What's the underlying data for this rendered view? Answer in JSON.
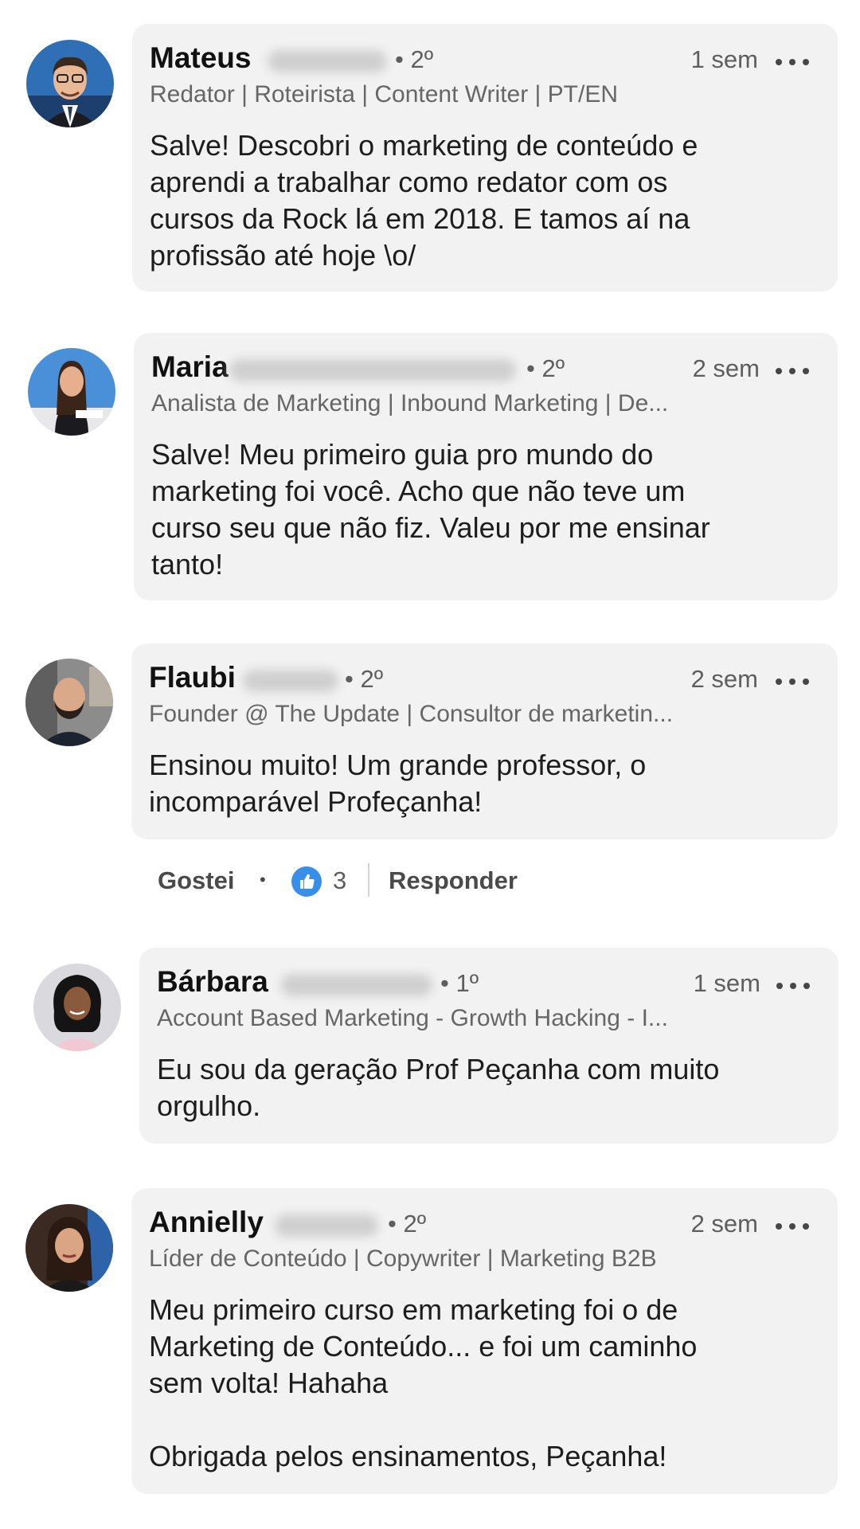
{
  "comments": [
    {
      "name": "Mateus",
      "degree": "• 2º",
      "time": "1 sem",
      "headline": "Redator | Roteirista | Content Writer | PT/EN",
      "text": "Salve! Descobri o marketing de conteúdo e\naprendi a trabalhar como redator com os\ncursos da Rock lá em 2018. E tamos aí na\nprofissão até hoje \\o/",
      "avatar_bg": "#2f6fb5"
    },
    {
      "name": "Maria",
      "degree": "• 2º",
      "time": "2 sem",
      "headline": "Analista de Marketing | Inbound Marketing | De...",
      "text": "Salve! Meu primeiro guia pro mundo do\nmarketing foi você. Acho que não teve um\ncurso seu que não fiz. Valeu por me ensinar\ntanto!",
      "avatar_bg": "#4a90d9"
    },
    {
      "name": "Flaubi",
      "degree": "• 2º",
      "time": "2 sem",
      "headline": "Founder @ The Update | Consultor de marketin...",
      "text": "Ensinou muito! Um grande professor, o\nincomparável Profeçanha!",
      "avatar_bg": "#7a7a7a"
    },
    {
      "name": "Bárbara",
      "degree": "• 1º",
      "time": "1 sem",
      "headline": "Account Based Marketing - Growth Hacking - I...",
      "text": "Eu sou da geração Prof Peçanha com muito\norgulho.",
      "avatar_bg": "#d9d9de"
    },
    {
      "name": "Annielly",
      "degree": "• 2º",
      "time": "2 sem",
      "headline": "Líder de Conteúdo | Copywriter | Marketing B2B",
      "text": "Meu primeiro curso em marketing foi o de\nMarketing de Conteúdo... e foi um caminho\nsem volta! Hahaha\n\nObrigada pelos ensinamentos, Peçanha!",
      "avatar_bg": "#3a2a22"
    }
  ],
  "actions": {
    "like_label": "Gostei",
    "like_count": "3",
    "reply_label": "Responder",
    "like_icon": "thumbs-up-icon"
  },
  "colors": {
    "bubble": "#f2f2f2",
    "like_blue": "#378fe9"
  }
}
